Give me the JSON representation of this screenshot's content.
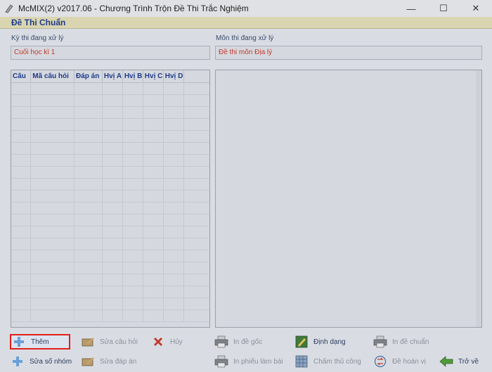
{
  "window": {
    "title": "McMIX(2) v2017.06 - Chương Trình Trộn Đề Thi Trắc Nghiệm",
    "minimize": "—",
    "maximize": "☐",
    "close": "✕"
  },
  "header": {
    "title": "Đề Thi Chuẩn"
  },
  "form": {
    "exam_label": "Kỳ thi đang xử lý",
    "exam_value": "Cuối học kì 1",
    "subject_label": "Môn thi đang xử lý",
    "subject_value": "Đề thi môn Địa lý"
  },
  "grid": {
    "columns": [
      "Câu",
      "Mã câu hỏi",
      "Đáp án",
      "Hvị A",
      "Hvị B",
      "Hvị C",
      "Hvị D"
    ],
    "row_count": 20
  },
  "buttons": {
    "them": "Thêm",
    "sua_cau_hoi": "Sửa câu hỏi",
    "huy": "Hủy",
    "in_de_goc": "In đề gốc",
    "dinh_dang": "Định dạng",
    "in_de_chuan": "In đề chuẩn",
    "sua_so_nhom": "Sửa số nhóm",
    "sua_dap_an": "Sửa đáp án",
    "in_phieu_lam_bai": "In phiếu làm bài",
    "cham_thu_cong": "Chấm thủ công",
    "de_hoan_vi": "Đề hoán vị",
    "tro_ve": "Trở về"
  },
  "colors": {
    "accent_red": "#e0201a",
    "header_bg": "#d9d5b0",
    "title_blue": "#1f3a8a"
  }
}
